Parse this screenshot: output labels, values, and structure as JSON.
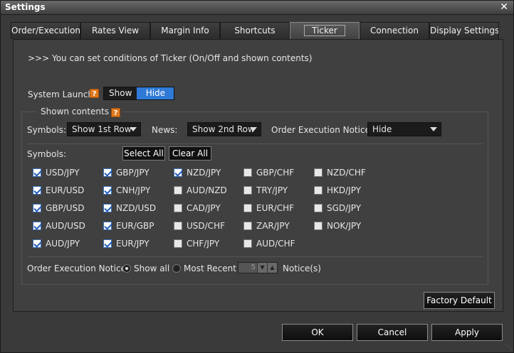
{
  "window": {
    "title": "Settings",
    "close_label": "✕"
  },
  "tabs": [
    {
      "label": "Order/Execution"
    },
    {
      "label": "Rates View"
    },
    {
      "label": "Margin Info"
    },
    {
      "label": "Shortcuts"
    },
    {
      "label": "Ticker",
      "active": true
    },
    {
      "label": "Connection"
    },
    {
      "label": "Display Settings"
    }
  ],
  "intro": ">>> You can set conditions of Ticker (On/Off and shown contents)",
  "launch": {
    "label": "System Launch:",
    "help": "?",
    "show": "Show",
    "hide": "Hide",
    "selected": "Hide"
  },
  "shown": {
    "legend": "Shown contents",
    "help": "?",
    "symbols_label": "Symbols:",
    "symbols_value": "Show 1st Row",
    "news_label": "News:",
    "news_value": "Show 2nd Row",
    "notice_label": "Order Execution Notice:",
    "notice_value": "Hide",
    "symbols_list_label": "Symbols:",
    "select_all": "Select All",
    "clear_all": "Clear All",
    "symbols": [
      [
        {
          "label": "USD/JPY",
          "checked": true
        },
        {
          "label": "GBP/JPY",
          "checked": true
        },
        {
          "label": "NZD/JPY",
          "checked": true
        },
        {
          "label": "GBP/CHF",
          "checked": false
        },
        {
          "label": "NZD/CHF",
          "checked": false
        }
      ],
      [
        {
          "label": "EUR/USD",
          "checked": true
        },
        {
          "label": "CNH/JPY",
          "checked": true
        },
        {
          "label": "AUD/NZD",
          "checked": false
        },
        {
          "label": "TRY/JPY",
          "checked": false
        },
        {
          "label": "HKD/JPY",
          "checked": false
        }
      ],
      [
        {
          "label": "GBP/USD",
          "checked": true
        },
        {
          "label": "NZD/USD",
          "checked": true
        },
        {
          "label": "CAD/JPY",
          "checked": false
        },
        {
          "label": "EUR/CHF",
          "checked": false
        },
        {
          "label": "SGD/JPY",
          "checked": false
        }
      ],
      [
        {
          "label": "AUD/USD",
          "checked": true
        },
        {
          "label": "EUR/GBP",
          "checked": true
        },
        {
          "label": "USD/CHF",
          "checked": false
        },
        {
          "label": "ZAR/JPY",
          "checked": false
        },
        {
          "label": "NOK/JPY",
          "checked": false
        }
      ],
      [
        {
          "label": "AUD/JPY",
          "checked": true
        },
        {
          "label": "EUR/JPY",
          "checked": true
        },
        {
          "label": "CHF/JPY",
          "checked": false
        },
        {
          "label": "AUD/CHF",
          "checked": false
        }
      ]
    ],
    "notice_mode_label": "Order Execution Notice:",
    "show_all": "Show all",
    "most_recent": "Most Recent",
    "recent_count": "5",
    "notices_label": "Notice(s)"
  },
  "factory_default": "Factory Default",
  "footer": {
    "ok": "OK",
    "cancel": "Cancel",
    "apply": "Apply"
  }
}
